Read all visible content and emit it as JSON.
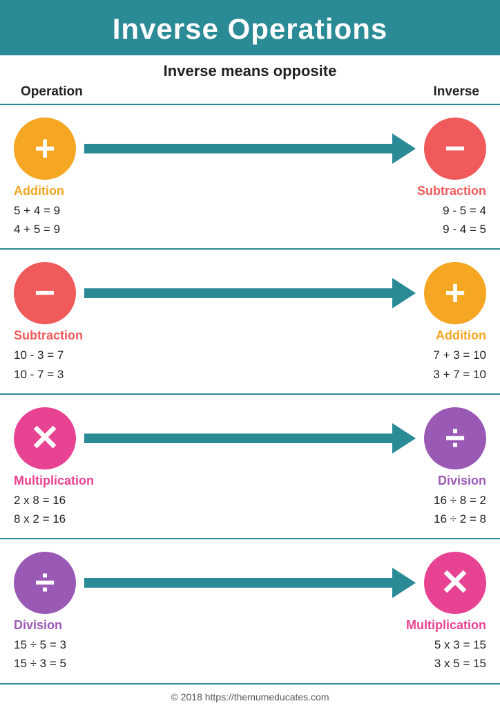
{
  "header": {
    "title": "Inverse Operations"
  },
  "subtitle": "Inverse means opposite",
  "col_labels": {
    "left": "Operation",
    "right": "Inverse"
  },
  "rows": [
    {
      "id": "addition-subtraction",
      "left": {
        "symbol": "+",
        "circle_class": "circle-orange",
        "label": "Addition",
        "label_class": "op-label-orange",
        "eq1": "5 + 4 = 9",
        "eq2": "4 + 5 = 9"
      },
      "right": {
        "symbol": "−",
        "circle_class": "circle-red",
        "label": "Subtraction",
        "label_class": "op-label-red",
        "eq1": "9 - 5 = 4",
        "eq2": "9 - 4 = 5"
      }
    },
    {
      "id": "subtraction-addition",
      "left": {
        "symbol": "−",
        "circle_class": "circle-red",
        "label": "Subtraction",
        "label_class": "op-label-red",
        "eq1": "10 - 3 = 7",
        "eq2": "10 - 7 = 3"
      },
      "right": {
        "symbol": "+",
        "circle_class": "circle-orange",
        "label": "Addition",
        "label_class": "op-label-orange",
        "eq1": "7 + 3 = 10",
        "eq2": "3 + 7 = 10"
      }
    },
    {
      "id": "multiplication-division",
      "left": {
        "symbol": "×",
        "circle_class": "circle-pink",
        "label": "Multiplication",
        "label_class": "op-label-pink",
        "eq1": "2  x 8 = 16",
        "eq2": "8 x 2 = 16"
      },
      "right": {
        "symbol": "÷",
        "circle_class": "circle-purple",
        "label": "Division",
        "label_class": "op-label-purple",
        "eq1": "16 ÷ 8 = 2",
        "eq2": "16 ÷ 2 = 8"
      }
    },
    {
      "id": "division-multiplication",
      "left": {
        "symbol": "÷",
        "circle_class": "circle-purple",
        "label": "Division",
        "label_class": "op-label-purple",
        "eq1": "15  ÷ 5 = 3",
        "eq2": "15 ÷ 3 = 5"
      },
      "right": {
        "symbol": "×",
        "circle_class": "circle-pink",
        "label": "Multiplication",
        "label_class": "op-label-pink",
        "eq1": "5 x 3 = 15",
        "eq2": "3 x 5 = 15"
      }
    }
  ],
  "footer": "© 2018   https://themumeducates.com"
}
